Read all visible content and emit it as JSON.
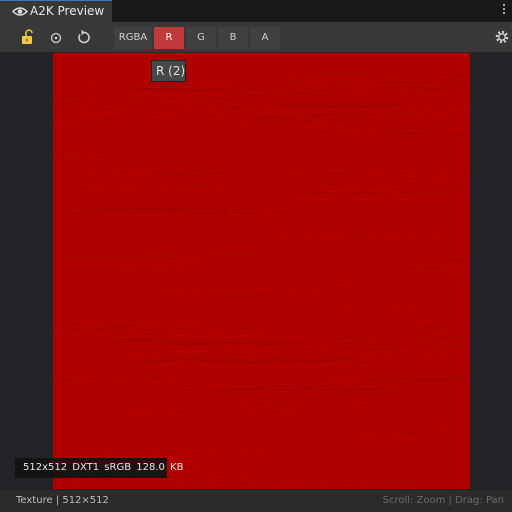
{
  "window": {
    "tab_title": "A2K Preview",
    "tab_icon": "eye-icon",
    "menu_icon": "kebab-menu-icon"
  },
  "toolbar": {
    "icons": [
      "unlock-icon",
      "target-icon",
      "refresh-icon",
      "settings-icon"
    ],
    "channels": [
      {
        "label": "RGBA",
        "active": false
      },
      {
        "label": "R",
        "active": true
      },
      {
        "label": "G",
        "active": false
      },
      {
        "label": "B",
        "active": false
      },
      {
        "label": "A",
        "active": false
      }
    ],
    "tooltip": "R (2)"
  },
  "preview": {
    "texture_color": "#b10000",
    "info": "512x512  DXT1  sRGB  128.0 KB"
  },
  "status": {
    "left": "Texture | 512×512",
    "right": "Scroll: Zoom | Drag: Pan"
  },
  "colors": {
    "accent": "#c0393b",
    "tab_underline": "#3a79bb"
  }
}
